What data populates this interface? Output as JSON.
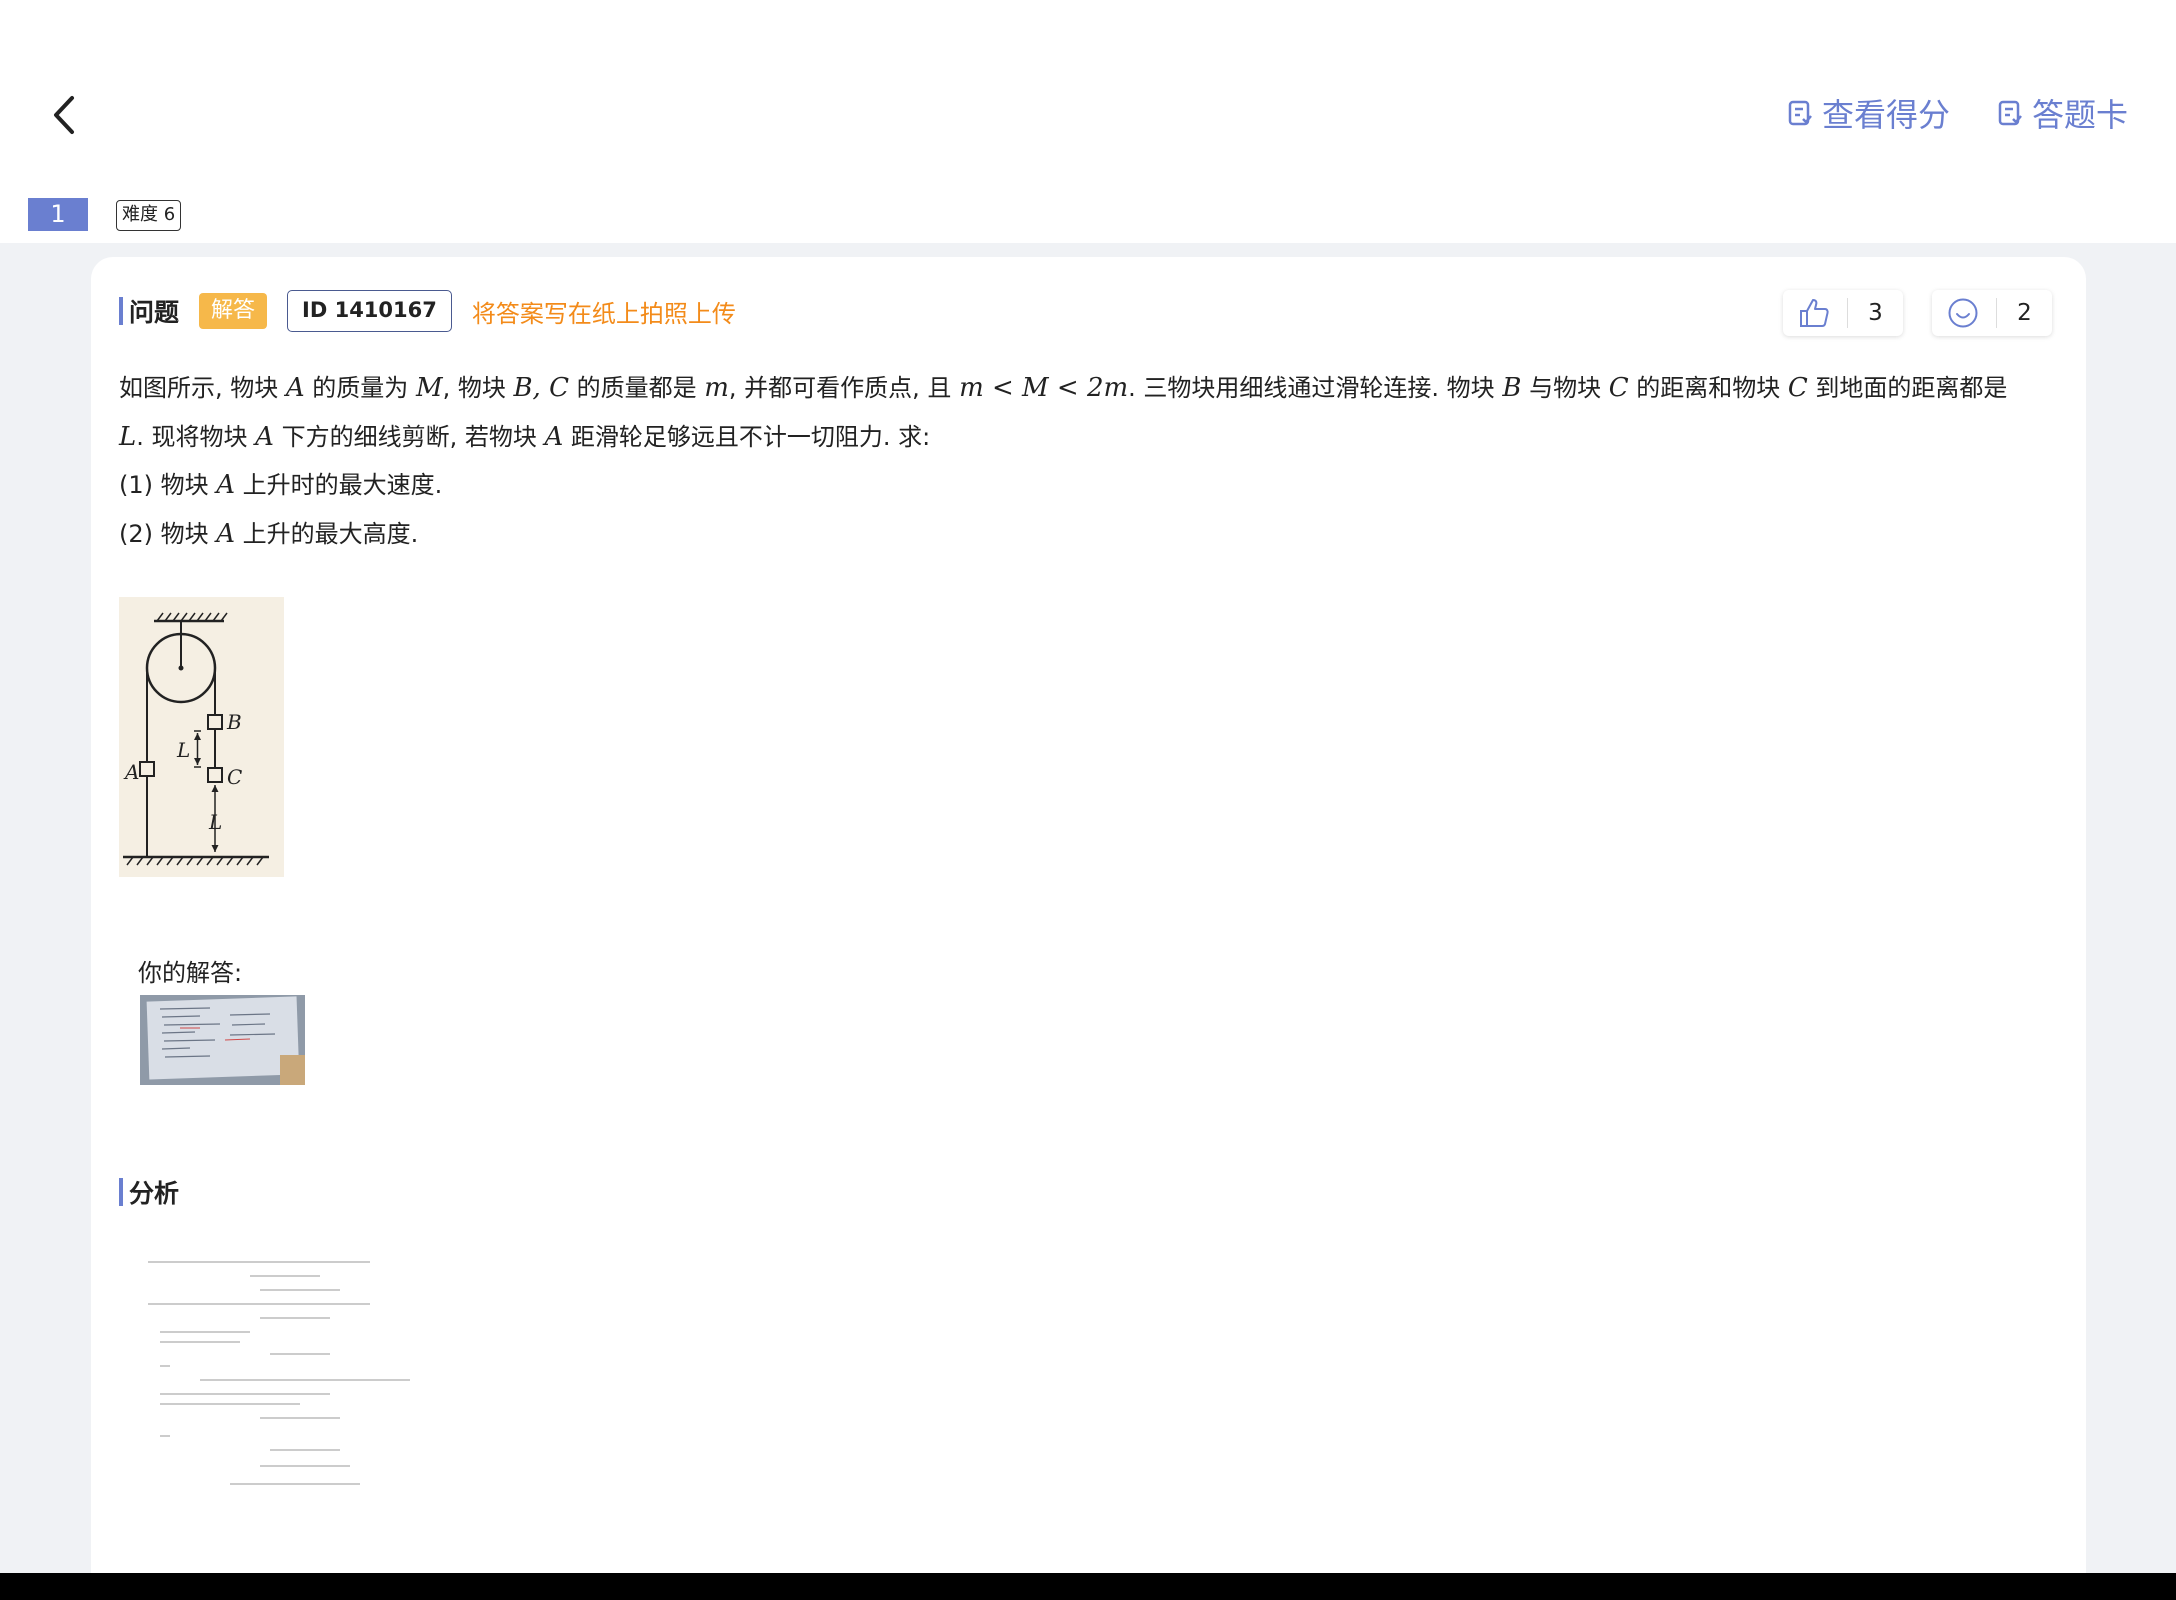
{
  "header": {
    "view_score_label": "查看得分",
    "answer_sheet_label": "答题卡",
    "accent_color": "#6a7fd0"
  },
  "question_nav": {
    "number": "1",
    "difficulty": "难度 6"
  },
  "question": {
    "section_title": "问题",
    "type_tag": "解答",
    "id_tag": "ID 1410167",
    "upload_hint": "将答案写在纸上拍照上传",
    "like_count": "3",
    "comment_count": "2",
    "text_parts": {
      "l1_a": "如图所示, 物块 ",
      "l1_A": "A",
      "l1_b": " 的质量为 ",
      "l1_M": "M",
      "l1_c": ", 物块 ",
      "l1_BC": "B, C",
      "l1_d": " 的质量都是 ",
      "l1_m": "m",
      "l1_e": ", 并都可看作质点, 且 ",
      "l1_ineq": "m < M < 2m",
      "l1_f": ". 三物块用细线通过滑轮连接. 物块 ",
      "l1_B": "B",
      "l1_g": " 与物块 ",
      "l1_C1": "C",
      "l1_h": " 的距离和物块 ",
      "l1_C2": "C",
      "l1_i": " 到地面的距离都是",
      "l2_L": "L",
      "l2_a": ". 现将物块 ",
      "l2_A1": "A",
      "l2_b": " 下方的细线剪断, 若物块 ",
      "l2_A2": "A",
      "l2_c": " 距滑轮足够远且不计一切阻力. 求:",
      "q1_a": "(1) 物块 ",
      "q1_A": "A",
      "q1_b": " 上升时的最大速度.",
      "q2_a": "(2) 物块 ",
      "q2_A": "A",
      "q2_b": " 上升的最大高度."
    },
    "figure_labels": {
      "A": "A",
      "B": "B",
      "C": "C",
      "L": "L"
    }
  },
  "your_answer_label": "你的解答:",
  "analysis": {
    "section_title": "分析"
  }
}
